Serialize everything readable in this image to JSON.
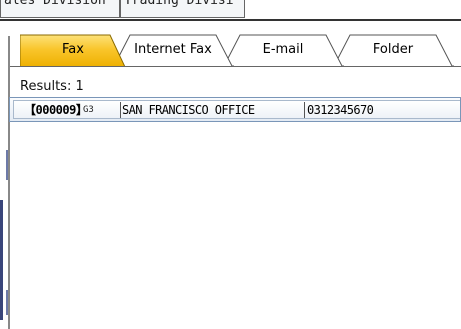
{
  "top_tabs": [
    {
      "label": "ales Division"
    },
    {
      "label": "Trading Divisi"
    }
  ],
  "sub_tabs": [
    {
      "label": "Fax",
      "active": true
    },
    {
      "label": "Internet Fax",
      "active": false
    },
    {
      "label": "E-mail",
      "active": false
    },
    {
      "label": "Folder",
      "active": false
    }
  ],
  "results_label": "Results: 1",
  "results": [
    {
      "id": "【000009】",
      "protocol": "G3",
      "name": "SAN FRANCISCO OFFICE",
      "number": "0312345670"
    }
  ],
  "colors": {
    "active_tab": "#f5b400",
    "inactive_tab": "#ffffff",
    "row_border": "#7a96b8",
    "side_bar": "#39457a"
  }
}
